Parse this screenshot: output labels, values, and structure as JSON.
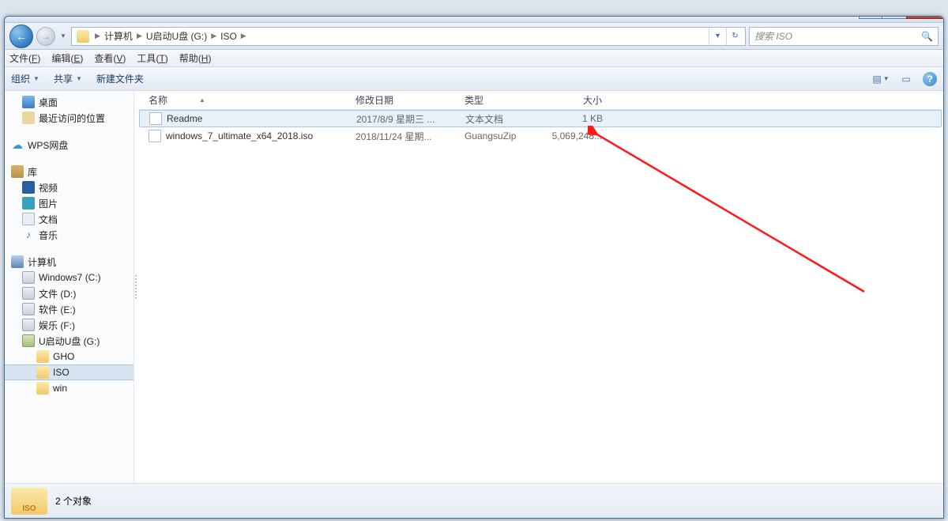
{
  "window_controls": {
    "min": "—",
    "max": "▣",
    "close": "✕"
  },
  "nav": {
    "back": "←",
    "forward": "→",
    "dropdown": "▼"
  },
  "breadcrumbs": [
    "计算机",
    "U启动U盘 (G:)",
    "ISO"
  ],
  "address_refresh": "↻",
  "address_drop": "▾",
  "search_placeholder": "搜索 ISO",
  "menubar": [
    {
      "label": "文件",
      "accel": "F"
    },
    {
      "label": "编辑",
      "accel": "E"
    },
    {
      "label": "查看",
      "accel": "V"
    },
    {
      "label": "工具",
      "accel": "T"
    },
    {
      "label": "帮助",
      "accel": "H"
    }
  ],
  "toolbar": {
    "organize": "组织",
    "share": "共享",
    "newfolder": "新建文件夹",
    "view_icon": "▤",
    "preview_icon": "▭",
    "help": "?"
  },
  "sidebar": {
    "desktop": "桌面",
    "recent": "最近访问的位置",
    "wps": "WPS网盘",
    "library": "库",
    "video": "视频",
    "image": "图片",
    "doc": "文档",
    "music": "音乐",
    "computer": "计算机",
    "drives": [
      "Windows7 (C:)",
      "文件 (D:)",
      "软件 (E:)",
      "娱乐 (F:)",
      "U启动U盘 (G:)"
    ],
    "folders": [
      "GHO",
      "ISO",
      "win"
    ]
  },
  "columns": {
    "name": "名称",
    "date": "修改日期",
    "type": "类型",
    "size": "大小"
  },
  "files": [
    {
      "name": "Readme",
      "date": "2017/8/9 星期三 ...",
      "type": "文本文档",
      "size": "1 KB",
      "selected": true
    },
    {
      "name": "windows_7_ultimate_x64_2018.iso",
      "date": "2018/11/24 星期...",
      "type": "GuangsuZip",
      "size": "5,069,248...",
      "selected": false
    }
  ],
  "status": {
    "count": "2 个对象",
    "folder_label": "ISO"
  }
}
